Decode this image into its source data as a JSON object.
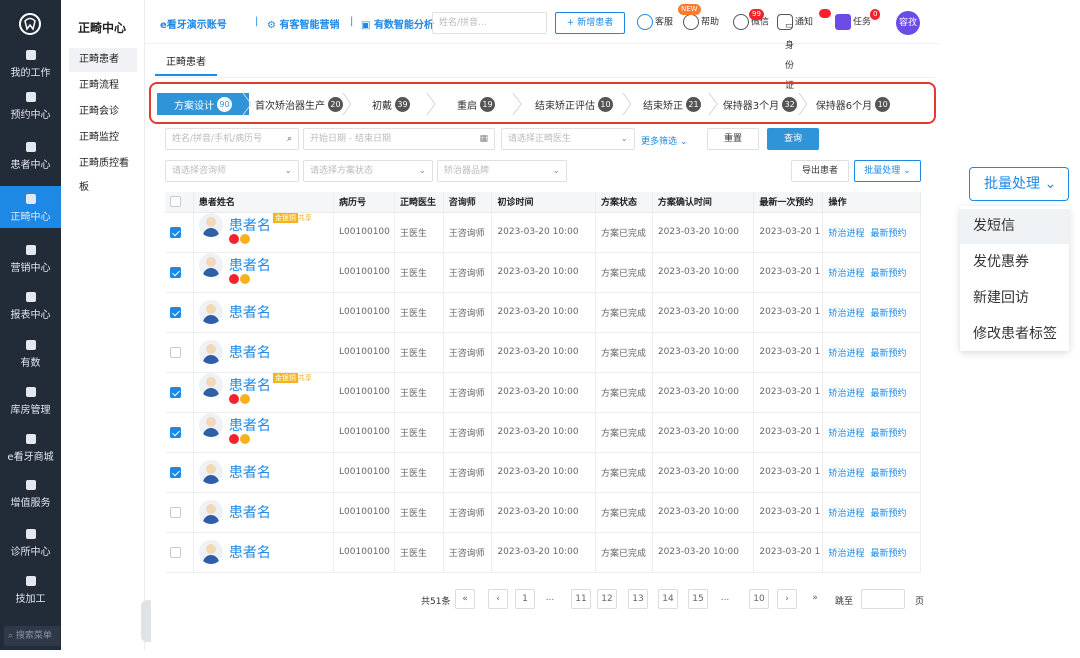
{
  "sidebar": {
    "items": [
      {
        "label": "我的工作",
        "icon": "work-icon"
      },
      {
        "label": "预约中心",
        "icon": "calendar-icon"
      },
      {
        "label": "患者中心",
        "icon": "patient-icon"
      },
      {
        "label": "正畸中心",
        "icon": "tooth-icon",
        "active": true
      },
      {
        "label": "营销中心",
        "icon": "marketing-icon"
      },
      {
        "label": "报表中心",
        "icon": "chart-icon"
      },
      {
        "label": "有数",
        "icon": "data-icon"
      },
      {
        "label": "库房管理",
        "icon": "warehouse-icon"
      },
      {
        "label": "e看牙商城",
        "icon": "mall-icon"
      },
      {
        "label": "增值服务",
        "icon": "grid-icon"
      },
      {
        "label": "诊所中心",
        "icon": "clinic-icon"
      },
      {
        "label": "技加工",
        "icon": "tools-icon"
      }
    ],
    "search_placeholder": "搜索菜单"
  },
  "submenu": {
    "title": "正畸中心",
    "items": [
      "正畸患者",
      "正畸流程",
      "正畸会诊",
      "正畸监控",
      "正畸质控看板"
    ]
  },
  "topbar": {
    "account": "e看牙演示账号",
    "sep": "|",
    "marketing": "有客智能营销",
    "analytics": "有数智能分析",
    "search_placeholder": "姓名/拼音...",
    "idcard": "身份证",
    "add_patient": "新增患者",
    "service": "客服",
    "help": "帮助",
    "new_badge": "NEW",
    "wechat": "微信",
    "wechat_badge": "99",
    "notify": "通知",
    "task": "任务",
    "task_badge": "0",
    "avatar_text": "容孜"
  },
  "page_tab": "正畸患者",
  "steps": [
    {
      "label": "方案设计",
      "count": "90"
    },
    {
      "label": "首次矫治器生产",
      "count": "20"
    },
    {
      "label": "初戴",
      "count": "39"
    },
    {
      "label": "重启",
      "count": "19"
    },
    {
      "label": "结束矫正评估",
      "count": "10"
    },
    {
      "label": "结束矫正",
      "count": "21"
    },
    {
      "label": "保持器3个月",
      "count": "32"
    },
    {
      "label": "保持器6个月",
      "count": "10"
    }
  ],
  "filters": {
    "search_placeholder": "姓名/拼音/手机/病历号",
    "date_placeholder": "开始日期 - 结束日期",
    "doctor_placeholder": "请选择正畸医生",
    "more": "更多筛选",
    "reset": "重置",
    "query": "查询",
    "consultant_placeholder": "请选择咨询师",
    "status_placeholder": "请选择方案状态",
    "brand_placeholder": "矫治器品牌",
    "export": "导出患者",
    "batch": "批量处理"
  },
  "table": {
    "headers": [
      "患者姓名",
      "病历号",
      "正畸医生",
      "咨询师",
      "初诊时间",
      "方案状态",
      "方案确认时间",
      "最新一次预约",
      "操作"
    ],
    "rows": [
      {
        "name": "患者名",
        "tag": "金银铜",
        "share": "共享",
        "checked": true,
        "minis": true,
        "record": "L00100100",
        "doctor": "王医生",
        "consultant": "王咨询师",
        "first_visit": "2023-03-20 10:00",
        "status": "方案已完成",
        "confirm_time": "2023-03-20 10:00",
        "latest": "2023-03-20 1",
        "op1": "矫治进程",
        "op2": "最新预约"
      },
      {
        "name": "患者名",
        "tag": "",
        "share": "",
        "checked": true,
        "minis": true,
        "record": "L00100100",
        "doctor": "王医生",
        "consultant": "王咨询师",
        "first_visit": "2023-03-20 10:00",
        "status": "方案已完成",
        "confirm_time": "2023-03-20 10:00",
        "latest": "2023-03-20 1",
        "op1": "矫治进程",
        "op2": "最新预约"
      },
      {
        "name": "患者名",
        "tag": "",
        "share": "",
        "checked": true,
        "minis": false,
        "record": "L00100100",
        "doctor": "王医生",
        "consultant": "王咨询师",
        "first_visit": "2023-03-20 10:00",
        "status": "方案已完成",
        "confirm_time": "2023-03-20 10:00",
        "latest": "2023-03-20 1",
        "op1": "矫治进程",
        "op2": "最新预约"
      },
      {
        "name": "患者名",
        "tag": "",
        "share": "",
        "checked": false,
        "minis": false,
        "record": "L00100100",
        "doctor": "王医生",
        "consultant": "王咨询师",
        "first_visit": "2023-03-20 10:00",
        "status": "方案已完成",
        "confirm_time": "2023-03-20 10:00",
        "latest": "2023-03-20 1",
        "op1": "矫治进程",
        "op2": "最新预约"
      },
      {
        "name": "患者名",
        "tag": "金银铜",
        "share": "共享",
        "checked": true,
        "minis": true,
        "record": "L00100100",
        "doctor": "王医生",
        "consultant": "王咨询师",
        "first_visit": "2023-03-20 10:00",
        "status": "方案已完成",
        "confirm_time": "2023-03-20 10:00",
        "latest": "2023-03-20 1",
        "op1": "矫治进程",
        "op2": "最新预约"
      },
      {
        "name": "患者名",
        "tag": "",
        "share": "",
        "checked": true,
        "minis": true,
        "record": "L00100100",
        "doctor": "王医生",
        "consultant": "王咨询师",
        "first_visit": "2023-03-20 10:00",
        "status": "方案已完成",
        "confirm_time": "2023-03-20 10:00",
        "latest": "2023-03-20 1",
        "op1": "矫治进程",
        "op2": "最新预约"
      },
      {
        "name": "患者名",
        "tag": "",
        "share": "",
        "checked": true,
        "minis": false,
        "record": "L00100100",
        "doctor": "王医生",
        "consultant": "王咨询师",
        "first_visit": "2023-03-20 10:00",
        "status": "方案已完成",
        "confirm_time": "2023-03-20 10:00",
        "latest": "2023-03-20 1",
        "op1": "矫治进程",
        "op2": "最新预约"
      },
      {
        "name": "患者名",
        "tag": "",
        "share": "",
        "checked": false,
        "minis": false,
        "record": "L00100100",
        "doctor": "王医生",
        "consultant": "王咨询师",
        "first_visit": "2023-03-20 10:00",
        "status": "方案已完成",
        "confirm_time": "2023-03-20 10:00",
        "latest": "2023-03-20 1",
        "op1": "矫治进程",
        "op2": "最新预约"
      },
      {
        "name": "患者名",
        "tag": "",
        "share": "",
        "checked": false,
        "minis": false,
        "record": "L00100100",
        "doctor": "王医生",
        "consultant": "王咨询师",
        "first_visit": "2023-03-20 10:00",
        "status": "方案已完成",
        "confirm_time": "2023-03-20 10:00",
        "latest": "2023-03-20 1",
        "op1": "矫治进程",
        "op2": "最新预约"
      }
    ]
  },
  "pagination": {
    "total": "共51条",
    "pages": [
      "1",
      "...",
      "11",
      "12",
      "13",
      "14",
      "15",
      "...",
      "10"
    ],
    "goto": "跳至",
    "page_unit": "页"
  },
  "batch_panel": {
    "button": "批量处理",
    "menu": [
      "发短信",
      "发优惠券",
      "新建回访",
      "修改患者标签"
    ]
  },
  "colors": {
    "primary": "#1e88e5",
    "sidebar_bg": "#222b38",
    "highlight": "#e53935"
  }
}
